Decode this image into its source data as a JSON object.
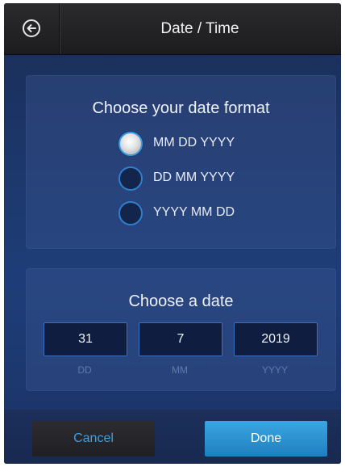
{
  "header": {
    "title": "Date / Time",
    "back_icon": "arrow-left-circle-icon"
  },
  "date_format": {
    "title": "Choose your date format",
    "options": [
      {
        "label": "MM DD YYYY",
        "selected": true
      },
      {
        "label": "DD MM YYYY",
        "selected": false
      },
      {
        "label": "YYYY MM DD",
        "selected": false
      }
    ]
  },
  "date": {
    "title": "Choose a date",
    "day": {
      "value": "31",
      "caption": "DD"
    },
    "month": {
      "value": "7",
      "caption": "MM"
    },
    "year": {
      "value": "2019",
      "caption": "YYYY"
    }
  },
  "footer": {
    "cancel_label": "Cancel",
    "done_label": "Done"
  },
  "colors": {
    "accent": "#2e7fd0",
    "done_button": "#2a93d0",
    "cancel_text": "#3f9fe0"
  }
}
